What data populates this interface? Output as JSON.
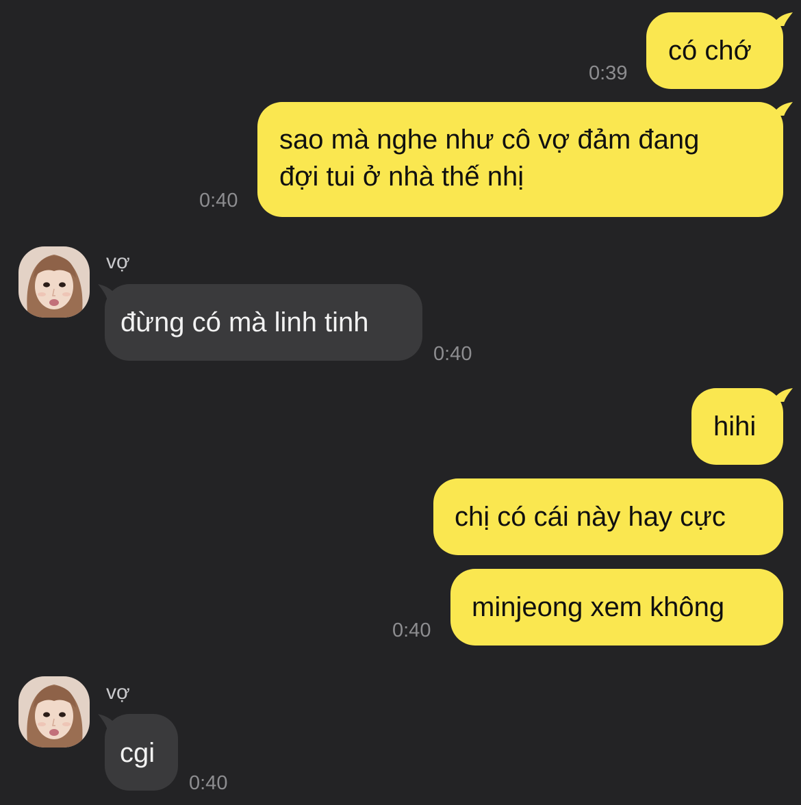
{
  "colors": {
    "background": "#232325",
    "my_bubble": "#fae750",
    "their_bubble": "#3a3a3c",
    "timestamp": "#8d8d90"
  },
  "messages": [
    {
      "id": "m1",
      "from": "me",
      "text": "có chớ",
      "time": "0:39"
    },
    {
      "id": "m2",
      "from": "me",
      "line1": "sao mà nghe như cô vợ đảm đang",
      "line2": "đợi tui ở nhà thế nhị",
      "time": "0:40"
    },
    {
      "id": "m3",
      "from": "them",
      "sender": "vợ",
      "text": "đừng có mà linh tinh",
      "time": "0:40",
      "avatar": "avatar-photo"
    },
    {
      "id": "m4",
      "from": "me",
      "text": "hihi"
    },
    {
      "id": "m5",
      "from": "me",
      "text": "chị có cái này hay cực"
    },
    {
      "id": "m6",
      "from": "me",
      "text": "minjeong xem không",
      "time": "0:40"
    },
    {
      "id": "m7",
      "from": "them",
      "sender": "vợ",
      "text": "cgi",
      "time": "0:40",
      "avatar": "avatar-photo"
    }
  ]
}
